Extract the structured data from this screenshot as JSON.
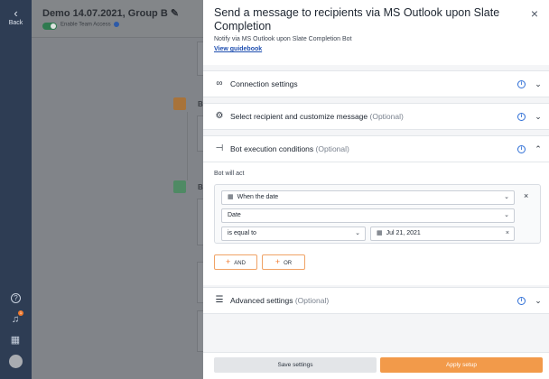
{
  "sidebar": {
    "back_label": "Back",
    "notification_count": "1",
    "icons": [
      "help-icon",
      "bell-icon",
      "calendar-icon",
      "avatar"
    ]
  },
  "app": {
    "title": "Demo 14.07.2021, Group B",
    "team_access_label": "Enable Team Access",
    "node_labels": [
      "Bo",
      "Bo"
    ]
  },
  "panel": {
    "title": "Send a message to recipients via MS Outlook upon Slate Completion",
    "subtitle": "Notify via MS Outlook upon Slate Completion Bot",
    "guide_link": "View guidebook",
    "sections": {
      "connection": {
        "label": "Connection settings",
        "optional": ""
      },
      "recipient": {
        "label": "Select recipient and customize message",
        "optional": "(Optional)"
      },
      "conditions": {
        "label": "Bot execution conditions",
        "optional": "(Optional)"
      },
      "advanced": {
        "label": "Advanced settings",
        "optional": "(Optional)"
      }
    },
    "conditions_body": {
      "bot_will_act": "Bot will act",
      "when_field": "When the date",
      "date_field": "Date",
      "operator_field": "is equal to",
      "date_value": "Jul 21, 2021",
      "and_label": "AND",
      "or_label": "OR"
    },
    "footer": {
      "save_label": "Save settings",
      "apply_label": "Apply setup"
    }
  },
  "colors": {
    "accent": "#f07a2e",
    "link": "#1f4fb0",
    "info": "#2f6fd6",
    "rail": "#2e3d54"
  }
}
